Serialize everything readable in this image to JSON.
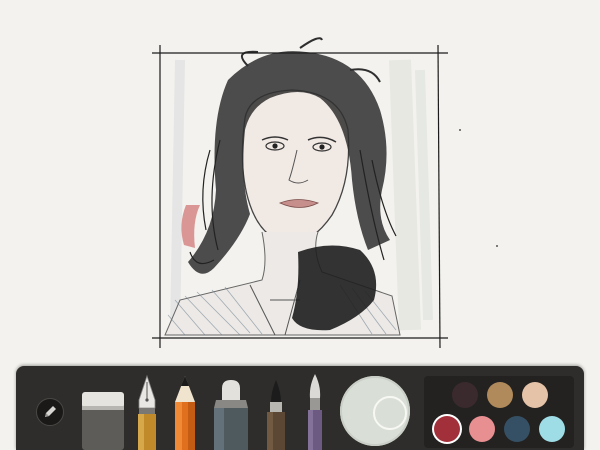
{
  "app": {
    "canvas_background": "#f3f2ee",
    "toolbar_background": "#2e2d2b"
  },
  "artwork": {
    "subject": "pencil-sketch-portrait",
    "frame_line_color": "#1c1c1c"
  },
  "toolbar": {
    "menu": {
      "icon": "pencil-circle-icon"
    },
    "tools": [
      {
        "name": "eraser",
        "icon": "eraser-icon",
        "color": "#6c6a66"
      },
      {
        "name": "fountain-pen",
        "icon": "fountain-pen-icon",
        "color": "#c08a2a"
      },
      {
        "name": "pencil",
        "icon": "pencil-icon",
        "color": "#e0701e",
        "selected": true
      },
      {
        "name": "marker",
        "icon": "marker-icon",
        "color": "#4e5a5e"
      },
      {
        "name": "brush",
        "icon": "brush-icon",
        "color": "#5b4733"
      },
      {
        "name": "watercolor",
        "icon": "watercolor-brush-icon",
        "color": "#6d5a82"
      }
    ],
    "mixer": {
      "icon": "color-mixer-icon",
      "current_color": "#d9dfd6"
    },
    "palette": [
      "#3a2a2e",
      "#b08a5a",
      "#e5c3a8",
      "#a2303a",
      "#e88f92",
      "#355064",
      "#9fdde6"
    ],
    "selected_swatch": 0
  }
}
